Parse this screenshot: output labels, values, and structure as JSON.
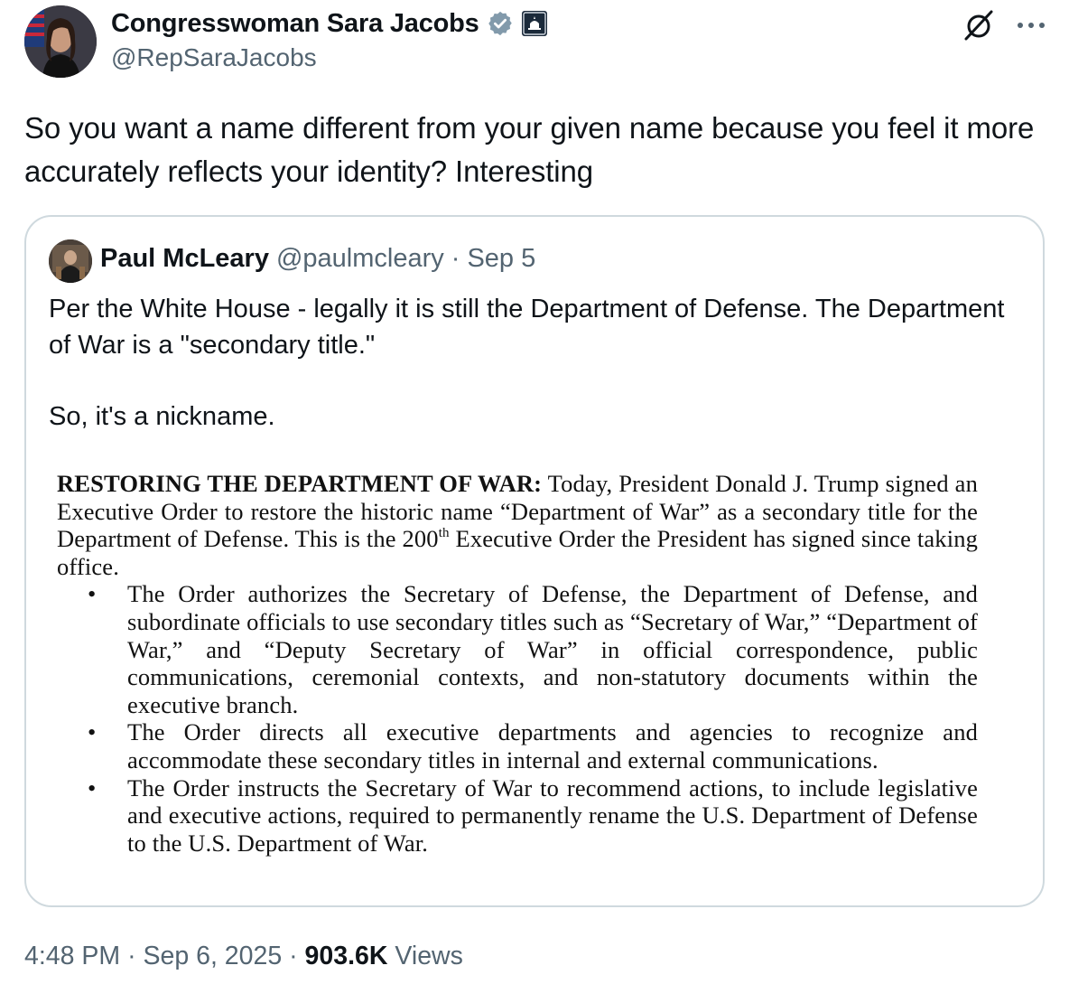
{
  "author": {
    "display_name": "Congresswoman Sara Jacobs",
    "handle": "@RepSaraJacobs",
    "avatar_icon": "profile-photo",
    "badge_icons": [
      "verified-badge",
      "government-affiliation-badge"
    ],
    "verified_color": "#829aab"
  },
  "tweet": {
    "text": "So you want a name different from your given name because you feel it more accurately reflects your identity? Interesting"
  },
  "quote": {
    "author_name": "Paul McLeary",
    "author_handle": "@paulmcleary",
    "separator": "·",
    "date": "Sep 5",
    "text_line1": "Per the White House - legally it is still the Department of Defense. The Department of War is a \"secondary title.\"",
    "text_line2": "So, it's a nickname.",
    "document": {
      "heading": "RESTORING THE DEPARTMENT OF WAR:",
      "intro_a": " Today, President Donald J. Trump signed an Executive Order to restore the historic name “Department of War” as a secondary title for the Department of Defense. This is the 200",
      "intro_sup": "th",
      "intro_b": " Executive Order the President has signed since taking office.",
      "bullet_char": "•",
      "bullets": [
        "The Order authorizes the Secretary of Defense, the Department of Defense, and subordinate officials to use secondary titles such as “Secretary of War,” “Department of War,” and “Deputy Secretary of War” in official correspondence, public communications, ceremonial contexts, and non-statutory documents within the executive branch.",
        "The Order directs all executive departments and agencies to recognize and accommodate these secondary titles in internal and external communications.",
        "The Order instructs the Secretary of War to recommend actions, to include legislative and executive actions, required to permanently rename the U.S. Department of Defense to the U.S. Department of War."
      ]
    }
  },
  "meta": {
    "time": "4:48 PM",
    "separator": "·",
    "date": "Sep 6, 2025",
    "views_count": "903.6K",
    "views_label": "Views"
  },
  "actions": {
    "grok_icon": "grok-icon",
    "more_icon": "more-options-icon"
  }
}
